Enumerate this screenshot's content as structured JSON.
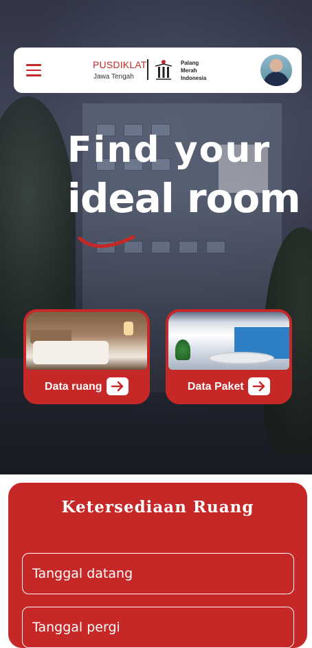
{
  "header": {
    "brand_name": "PUSDIKLAT",
    "brand_sub": "Jawa Tengah",
    "org_line1": "Palang",
    "org_line2": "Merah",
    "org_line3": "Indonesia"
  },
  "hero": {
    "headline_line1": "Find your",
    "headline_line2": "ideal room"
  },
  "cards": [
    {
      "label": "Data ruang"
    },
    {
      "label": "Data Paket"
    }
  ],
  "availability": {
    "title": "Ketersediaan Ruang",
    "arrival_placeholder": "Tanggal datang",
    "departure_placeholder": "Tanggal pergi"
  },
  "colors": {
    "primary": "#c62828",
    "white": "#ffffff"
  },
  "icons": {
    "menu": "hamburger-menu-icon",
    "arrow": "arrow-right-icon"
  }
}
